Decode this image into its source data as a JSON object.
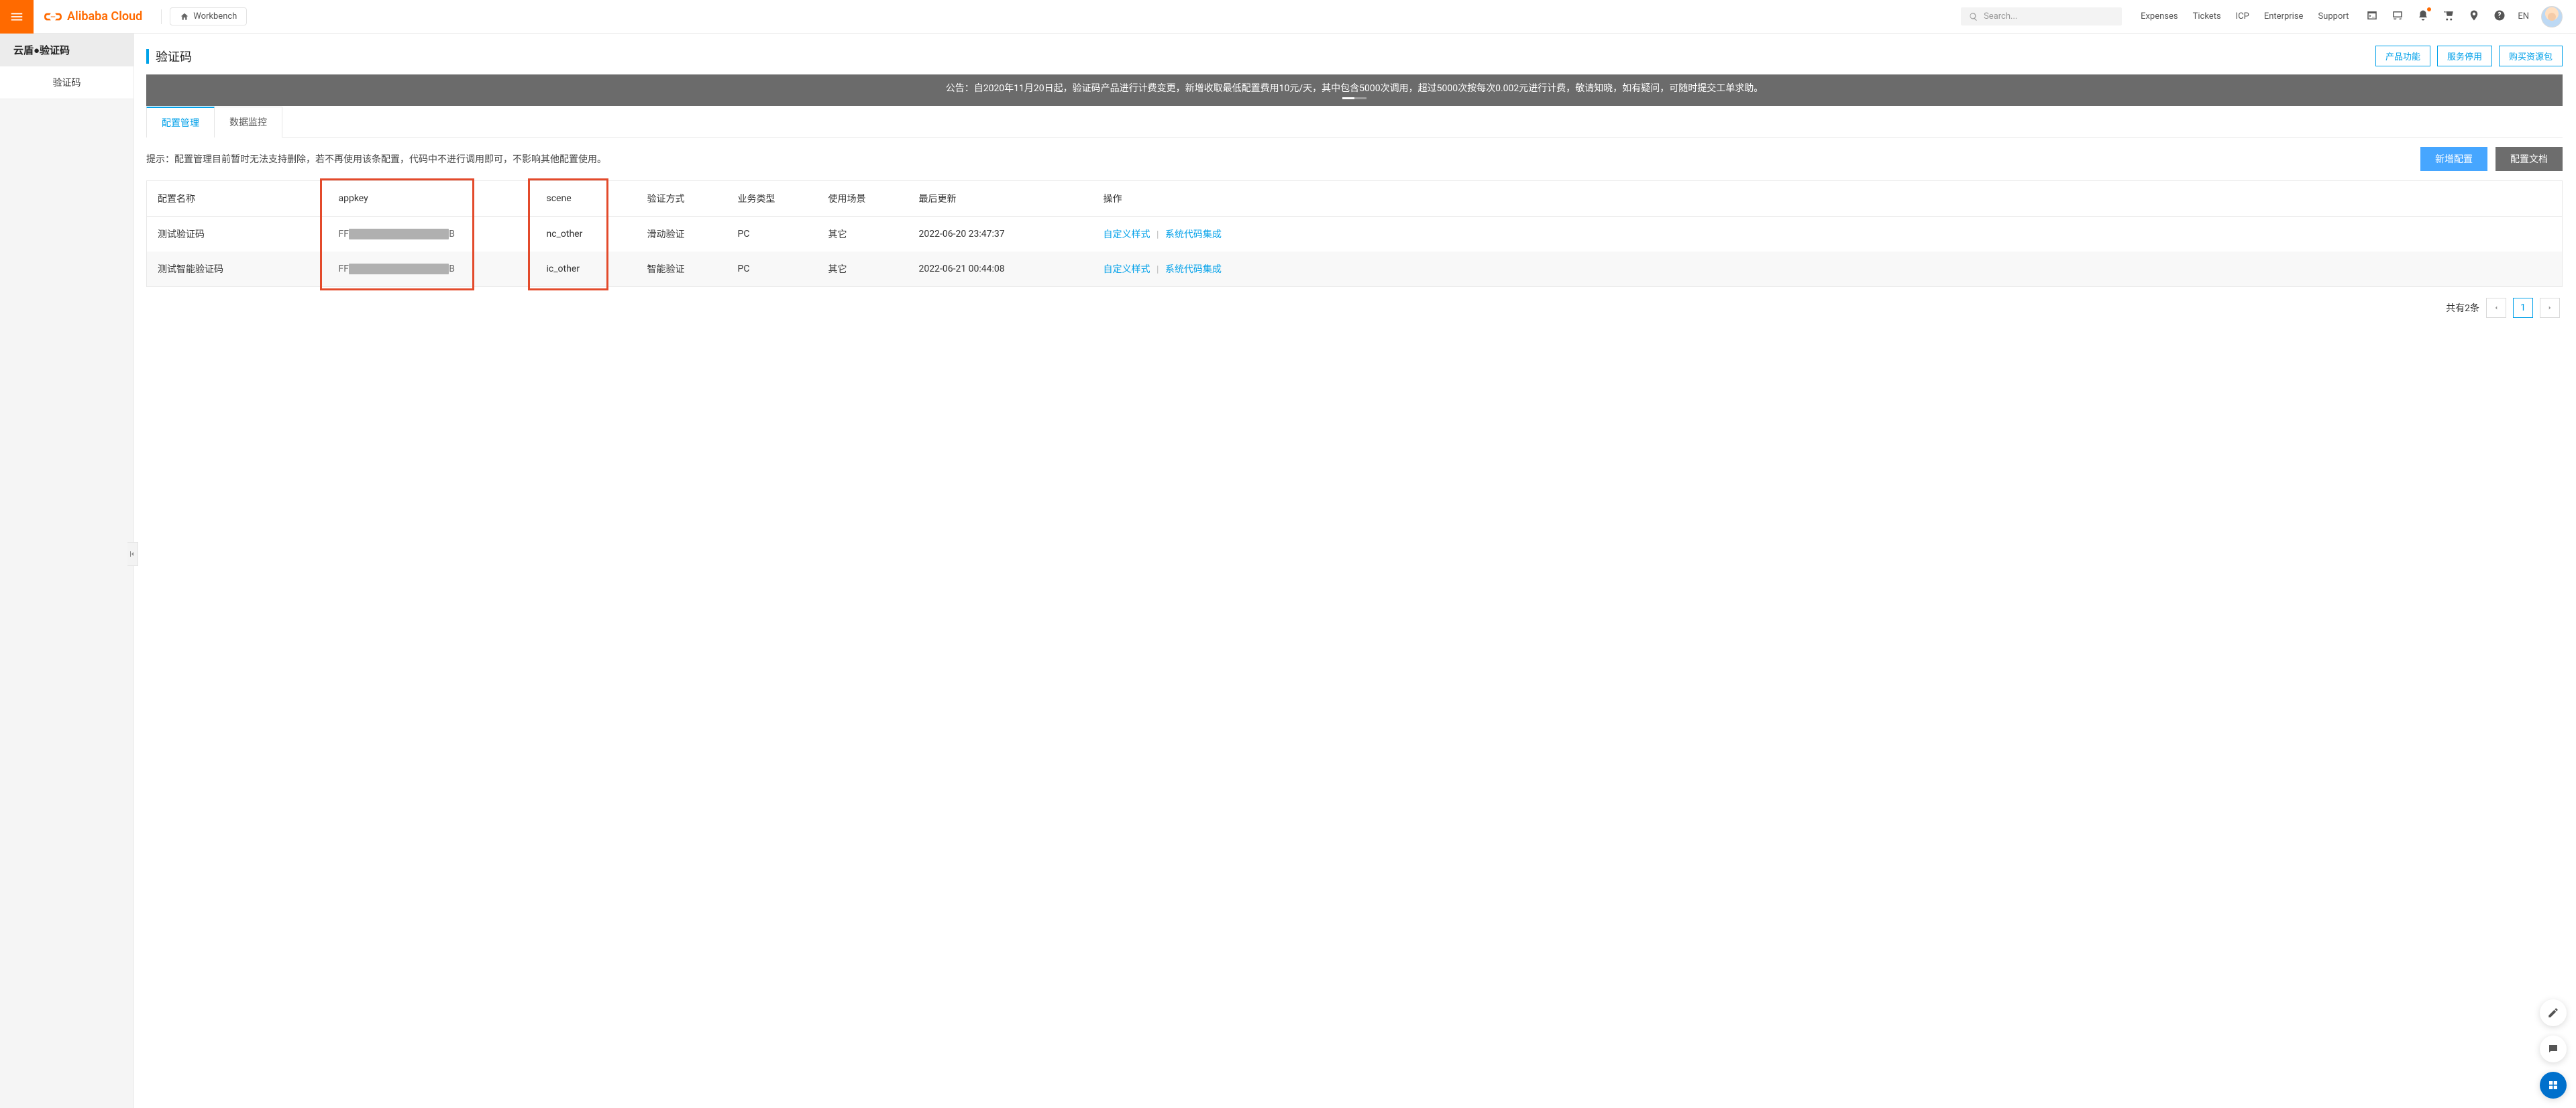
{
  "header": {
    "brand": "Alibaba Cloud",
    "workbench": "Workbench",
    "search_placeholder": "Search...",
    "links": {
      "expenses": "Expenses",
      "tickets": "Tickets",
      "icp": "ICP",
      "enterprise": "Enterprise",
      "support": "Support"
    },
    "lang": "EN"
  },
  "sidebar": {
    "title": "云盾●验证码",
    "items": [
      "验证码"
    ]
  },
  "page": {
    "title": "验证码",
    "actions": {
      "product_features": "产品功能",
      "stop_service": "服务停用",
      "buy_package": "购买资源包"
    }
  },
  "announce": "公告：自2020年11月20日起，验证码产品进行计费变更，新增收取最低配置费用10元/天，其中包含5000次调用，超过5000次按每次0.002元进行计费，敬请知晓，如有疑问，可随时提交工单求助。",
  "tabs": {
    "config": "配置管理",
    "monitor": "数据监控"
  },
  "hint": "提示：配置管理目前暂时无法支持删除，若不再使用该条配置，代码中不进行调用即可，不影响其他配置使用。",
  "buttons": {
    "new_config": "新增配置",
    "config_docs": "配置文档"
  },
  "table": {
    "columns": {
      "name": "配置名称",
      "appkey": "appkey",
      "scene": "scene",
      "verify": "验证方式",
      "business": "业务类型",
      "usage": "使用场景",
      "updated": "最后更新",
      "ops": "操作"
    },
    "rows": [
      {
        "name": "测试验证码",
        "appkey_prefix": "FF",
        "appkey_suffix": "B",
        "scene": "nc_other",
        "verify": "滑动验证",
        "business": "PC",
        "usage": "其它",
        "updated": "2022-06-20 23:47:37"
      },
      {
        "name": "测试智能验证码",
        "appkey_prefix": "FF",
        "appkey_suffix": "B",
        "scene": "ic_other",
        "verify": "智能验证",
        "business": "PC",
        "usage": "其它",
        "updated": "2022-06-21 00:44:08"
      }
    ],
    "ops": {
      "style": "自定义样式",
      "integrate": "系统代码集成"
    }
  },
  "pager": {
    "total": "共有2条",
    "current": "1"
  }
}
